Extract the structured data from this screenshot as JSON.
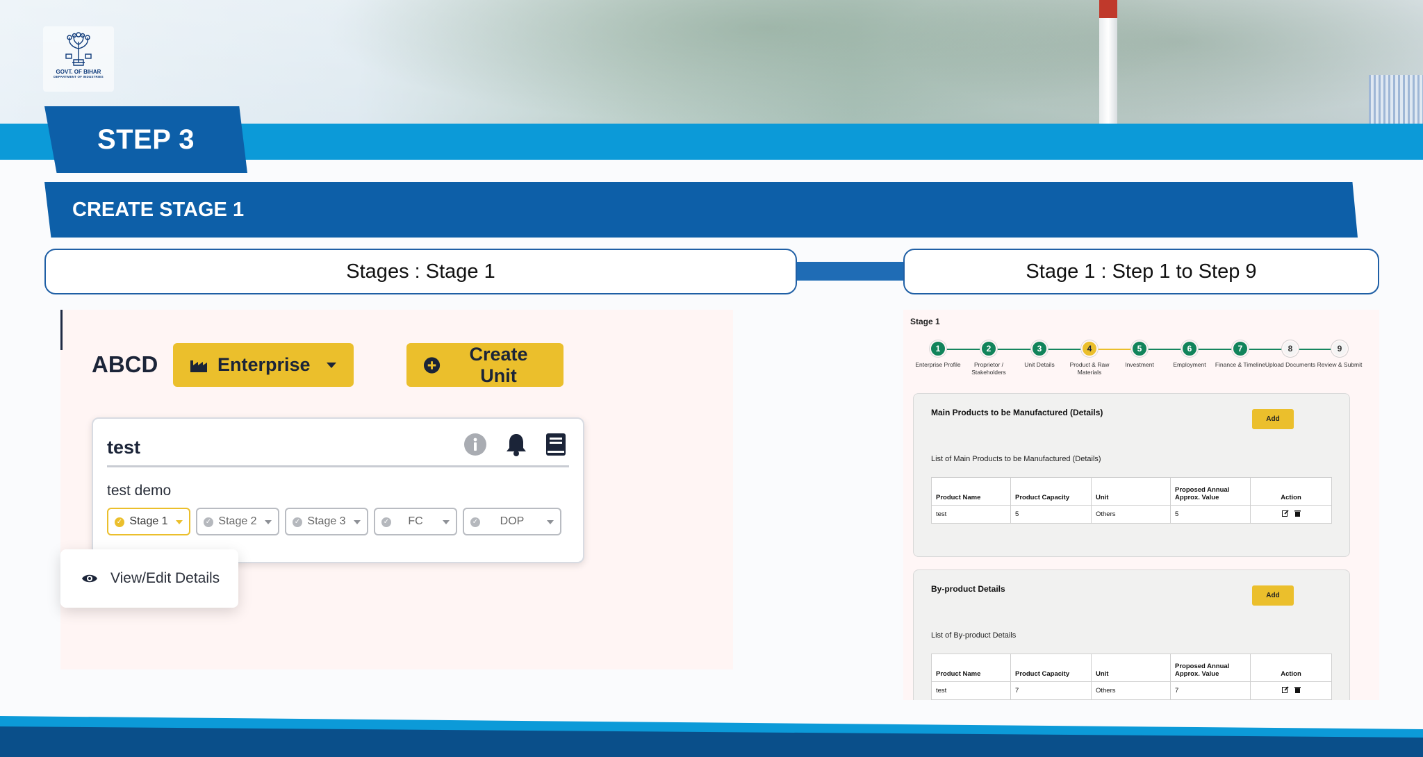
{
  "logo": {
    "line1": "GOVT. OF BIHAR",
    "line2": "DEPARTMENT OF INDUSTRIES"
  },
  "step_label": "STEP 3",
  "section_title": "CREATE STAGE 1",
  "left_pill": "Stages : Stage 1",
  "right_pill": "Stage 1 : Step 1 to Step 9",
  "dashboard": {
    "org_name": "ABCD",
    "enterprise_button": "Enterprise",
    "create_unit_button": "Create Unit",
    "card": {
      "title": "test",
      "description": "test demo",
      "stages": [
        {
          "label": "Stage 1",
          "active": true
        },
        {
          "label": "Stage 2",
          "active": false
        },
        {
          "label": "Stage 3",
          "active": false
        },
        {
          "label": "FC",
          "active": false
        },
        {
          "label": "DOP",
          "active": false
        }
      ]
    },
    "popover_item": "View/Edit Details"
  },
  "form": {
    "title": "Stage 1",
    "steps": [
      {
        "num": "1",
        "label": "Enterprise Profile",
        "state": "done"
      },
      {
        "num": "2",
        "label": "Proprietor / Stakeholders",
        "state": "done"
      },
      {
        "num": "3",
        "label": "Unit Details",
        "state": "done"
      },
      {
        "num": "4",
        "label": "Product & Raw Materials",
        "state": "current"
      },
      {
        "num": "5",
        "label": "Investment",
        "state": "done"
      },
      {
        "num": "6",
        "label": "Employment",
        "state": "done"
      },
      {
        "num": "7",
        "label": "Finance & Timeline",
        "state": "done"
      },
      {
        "num": "8",
        "label": "Upload Documents",
        "state": "todo"
      },
      {
        "num": "9",
        "label": "Review & Submit",
        "state": "todo"
      }
    ],
    "main_products": {
      "heading": "Main Products to be Manufactured (Details)",
      "add_label": "Add",
      "list_title": "List of Main Products to be Manufactured (Details)",
      "columns": [
        "Product Name",
        "Product Capacity",
        "Unit",
        "Proposed Annual Approx. Value",
        "Action"
      ],
      "rows": [
        [
          "test",
          "5",
          "Others",
          "5"
        ]
      ]
    },
    "by_products": {
      "heading": "By-product Details",
      "add_label": "Add",
      "list_title": "List of By-product Details",
      "columns": [
        "Product Name",
        "Product Capacity",
        "Unit",
        "Proposed Annual Approx. Value",
        "Action"
      ],
      "rows": [
        [
          "test",
          "7",
          "Others",
          "7"
        ]
      ]
    }
  },
  "colors": {
    "brand_blue": "#0d5fa8",
    "band_blue": "#0c9ad8",
    "accent_yellow": "#ebbf2c",
    "step_green": "#11845b"
  }
}
